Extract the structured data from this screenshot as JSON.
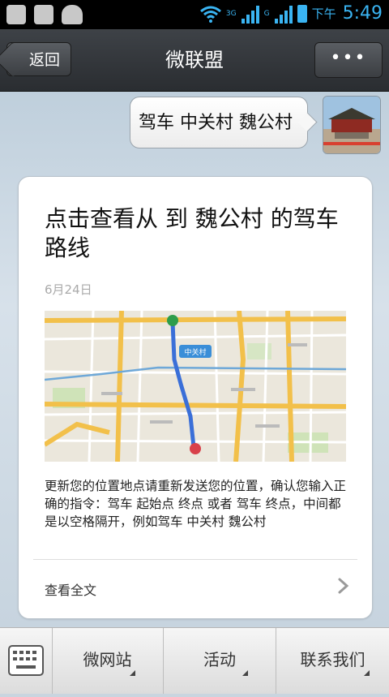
{
  "status_bar": {
    "ampm": "下午",
    "time": "5:49",
    "network_3g": "3G",
    "network_g": "G"
  },
  "title_bar": {
    "back_label": "返回",
    "title": "微联盟",
    "more_label": "•••"
  },
  "chat": {
    "sent_message": "驾车 中关村 魏公村",
    "card": {
      "title": "点击查看从 到 魏公村 的驾车路线",
      "date": "6月24日",
      "description": "更新您的位置地点请重新发送您的位置，确认您输入正确的指令：驾车 起始点 终点 或者 驾车 终点，中间都是以空格隔开，例如驾车 中关村 魏公村",
      "read_all": "查看全文",
      "map_label": "中关村"
    }
  },
  "bottom_bar": {
    "items": [
      {
        "label": "微网站"
      },
      {
        "label": "活动"
      },
      {
        "label": "联系我们"
      }
    ]
  },
  "colors": {
    "status_accent": "#3ab4f2",
    "title_bar": "#2f3236",
    "chat_bg": "#c9d5df",
    "route_blue": "#3a6fd8"
  }
}
